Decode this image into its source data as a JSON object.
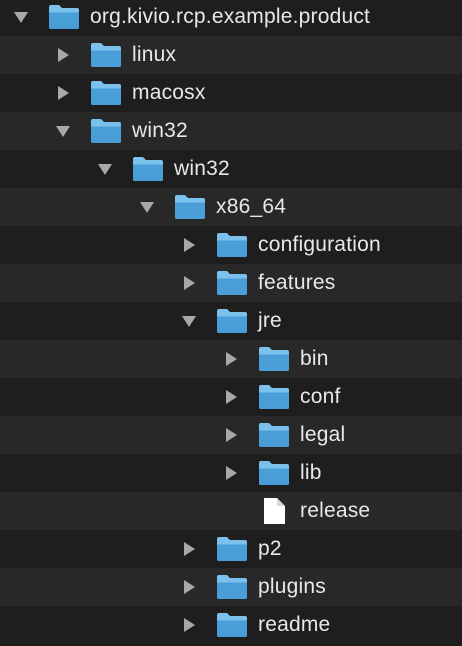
{
  "colors": {
    "background": "#1e1e1e",
    "row_alt": "#282828",
    "text": "#e8e8e8",
    "triangle": "#a8a8a8",
    "folder_body": "#4a9ed8",
    "folder_tab": "#7cc0ec",
    "file": "#ffffff"
  },
  "rows": [
    {
      "label": "org.kivio.rcp.example.product",
      "depth": 0,
      "kind": "folder",
      "expanded": true
    },
    {
      "label": "linux",
      "depth": 1,
      "kind": "folder",
      "expanded": false
    },
    {
      "label": "macosx",
      "depth": 1,
      "kind": "folder",
      "expanded": false
    },
    {
      "label": "win32",
      "depth": 1,
      "kind": "folder",
      "expanded": true
    },
    {
      "label": "win32",
      "depth": 2,
      "kind": "folder",
      "expanded": true
    },
    {
      "label": "x86_64",
      "depth": 3,
      "kind": "folder",
      "expanded": true
    },
    {
      "label": "configuration",
      "depth": 4,
      "kind": "folder",
      "expanded": false
    },
    {
      "label": "features",
      "depth": 4,
      "kind": "folder",
      "expanded": false
    },
    {
      "label": "jre",
      "depth": 4,
      "kind": "folder",
      "expanded": true
    },
    {
      "label": "bin",
      "depth": 5,
      "kind": "folder",
      "expanded": false
    },
    {
      "label": "conf",
      "depth": 5,
      "kind": "folder",
      "expanded": false
    },
    {
      "label": "legal",
      "depth": 5,
      "kind": "folder",
      "expanded": false
    },
    {
      "label": "lib",
      "depth": 5,
      "kind": "folder",
      "expanded": false
    },
    {
      "label": "release",
      "depth": 5,
      "kind": "file",
      "expanded": null
    },
    {
      "label": "p2",
      "depth": 4,
      "kind": "folder",
      "expanded": false
    },
    {
      "label": "plugins",
      "depth": 4,
      "kind": "folder",
      "expanded": false
    },
    {
      "label": "readme",
      "depth": 4,
      "kind": "folder",
      "expanded": false
    }
  ]
}
